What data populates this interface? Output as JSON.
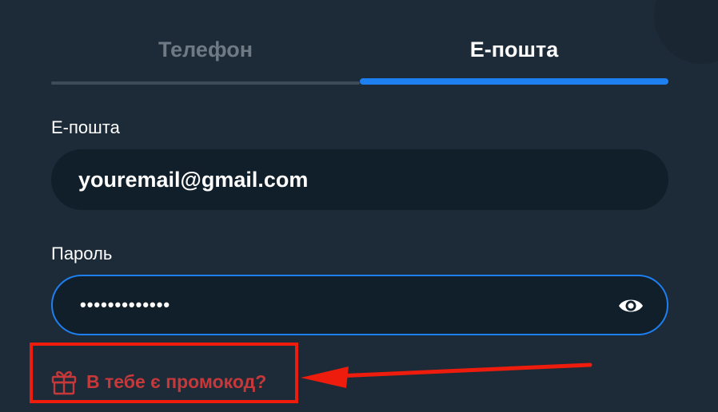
{
  "tabs": [
    {
      "label": "Телефон",
      "active": false
    },
    {
      "label": "Е-пошта",
      "active": true
    }
  ],
  "email_field": {
    "label": "Е-пошта",
    "value": "youremail@gmail.com"
  },
  "password_field": {
    "label": "Пароль",
    "value": "•••••••••••••",
    "toggle_icon": "eye-icon"
  },
  "promo": {
    "icon": "gift-icon",
    "label": "В тебе є промокод?"
  },
  "colors": {
    "background": "#1d2b38",
    "field_background": "#111f2b",
    "accent": "#1e7ff0",
    "promo": "#c6383a",
    "annotation": "#ee1c0c"
  }
}
